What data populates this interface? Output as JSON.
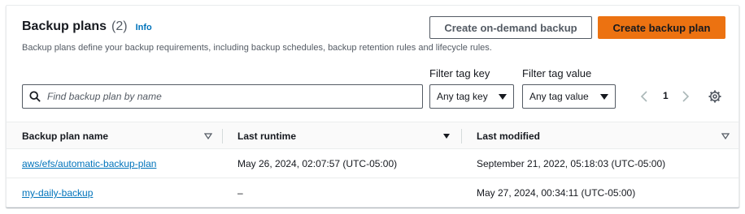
{
  "header": {
    "title": "Backup plans",
    "count": "(2)",
    "info_link": "Info",
    "description": "Backup plans define your backup requirements, including backup schedules, backup retention rules and lifecycle rules.",
    "on_demand_button": "Create on-demand backup",
    "create_button": "Create backup plan"
  },
  "filters": {
    "search_placeholder": "Find backup plan by name",
    "tag_key_label": "Filter tag key",
    "tag_key_value": "Any tag key",
    "tag_value_label": "Filter tag value",
    "tag_value_value": "Any tag value"
  },
  "pagination": {
    "current_page": "1"
  },
  "table": {
    "columns": [
      "Backup plan name",
      "Last runtime",
      "Last modified"
    ],
    "rows": [
      {
        "name": "aws/efs/automatic-backup-plan",
        "last_runtime": "May 26, 2024, 02:07:57 (UTC-05:00)",
        "last_modified": "September 21, 2022, 05:18:03 (UTC-05:00)"
      },
      {
        "name": "my-daily-backup",
        "last_runtime": "–",
        "last_modified": "May 27, 2024, 00:34:11 (UTC-05:00)"
      }
    ]
  },
  "colors": {
    "primary": "#ec7211",
    "link": "#0073bb",
    "text": "#16191f",
    "muted": "#545b64"
  }
}
